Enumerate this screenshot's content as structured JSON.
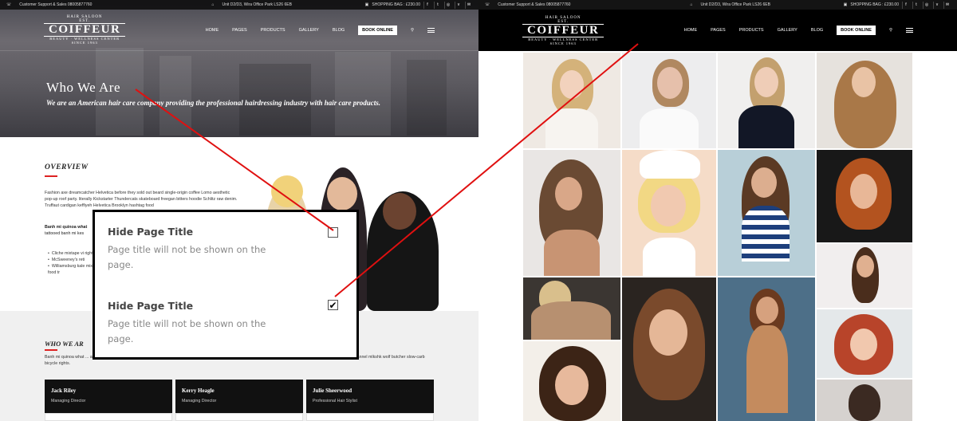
{
  "site": {
    "topbar": {
      "support": "Customer Support & Sales 08005877760",
      "address": "Unit D2/D3, Wira Office Park LS26 6EB",
      "cart": "SHOPPING BAG : £230.00"
    },
    "logo": {
      "top": "HAIR SALOON",
      "est": "EST.",
      "name": "COIFFEUR",
      "tagline": "BEAUTY · WELLNESS CENTER",
      "since": "SINCE 1963"
    },
    "nav": [
      "HOME",
      "PAGES",
      "PRODUCTS",
      "GALLERY",
      "BLOG"
    ],
    "book_button": "BOOK ONLINE"
  },
  "left": {
    "hero_title": "Who We Are",
    "hero_subtitle": "We are an American hair care company providing the professional hairdressing industry with hair care products.",
    "overview_heading": "OVERVIEW",
    "overview_text": "Fashion axe dreamcatcher Helvetica before they sold out beard single-origin coffee Lomo aesthetic pop-up roof party. literally Kickstarter Thundercats skateboard freegan bitters hoodie Schlitz raw denim. Truffaut cardigan keffiyeh Helvetica Brooklyn hashtag food",
    "overview_bold": "Banh mi quinoa what",
    "overview_bold_rest": "tattooed banh mi kes",
    "bullets": [
      "Cliche mixtape vi rights.",
      "McSweeney's reti",
      "Williamsburg kale mixtape food tr"
    ],
    "who_heading": "WHO WE AR",
    "who_text": "Banh mi quinoa what ... asymmetrical flexitarian Irony chambray typewriter, dred banh mi stumptown Banksy sustainable Etsy sriracha. Cliche mixtape vinyl cardigan, flannel mlkshk wolf butcher slow-carb bicycle rights.",
    "team": [
      {
        "name": "Jack Riley",
        "role": "Managing Director"
      },
      {
        "name": "Kerry Heagle",
        "role": "Managing Director"
      },
      {
        "name": "Julie Sheerwood",
        "role": "Professional Hair Stylist"
      }
    ]
  },
  "popup": {
    "options": [
      {
        "title": "Hide Page Title",
        "description": "Page title will not be shown on the page.",
        "checked": false
      },
      {
        "title": "Hide Page Title",
        "description": "Page title will not be shown on the page.",
        "checked": true
      }
    ]
  },
  "colors": {
    "accent_red": "#d22222",
    "dark": "#111111"
  },
  "icons": [
    "phone-icon",
    "location-icon",
    "bag-icon",
    "facebook-icon",
    "twitter-icon",
    "instagram-icon",
    "vimeo-icon",
    "mail-icon",
    "search-icon",
    "menu-icon",
    "checkbox-icon"
  ]
}
